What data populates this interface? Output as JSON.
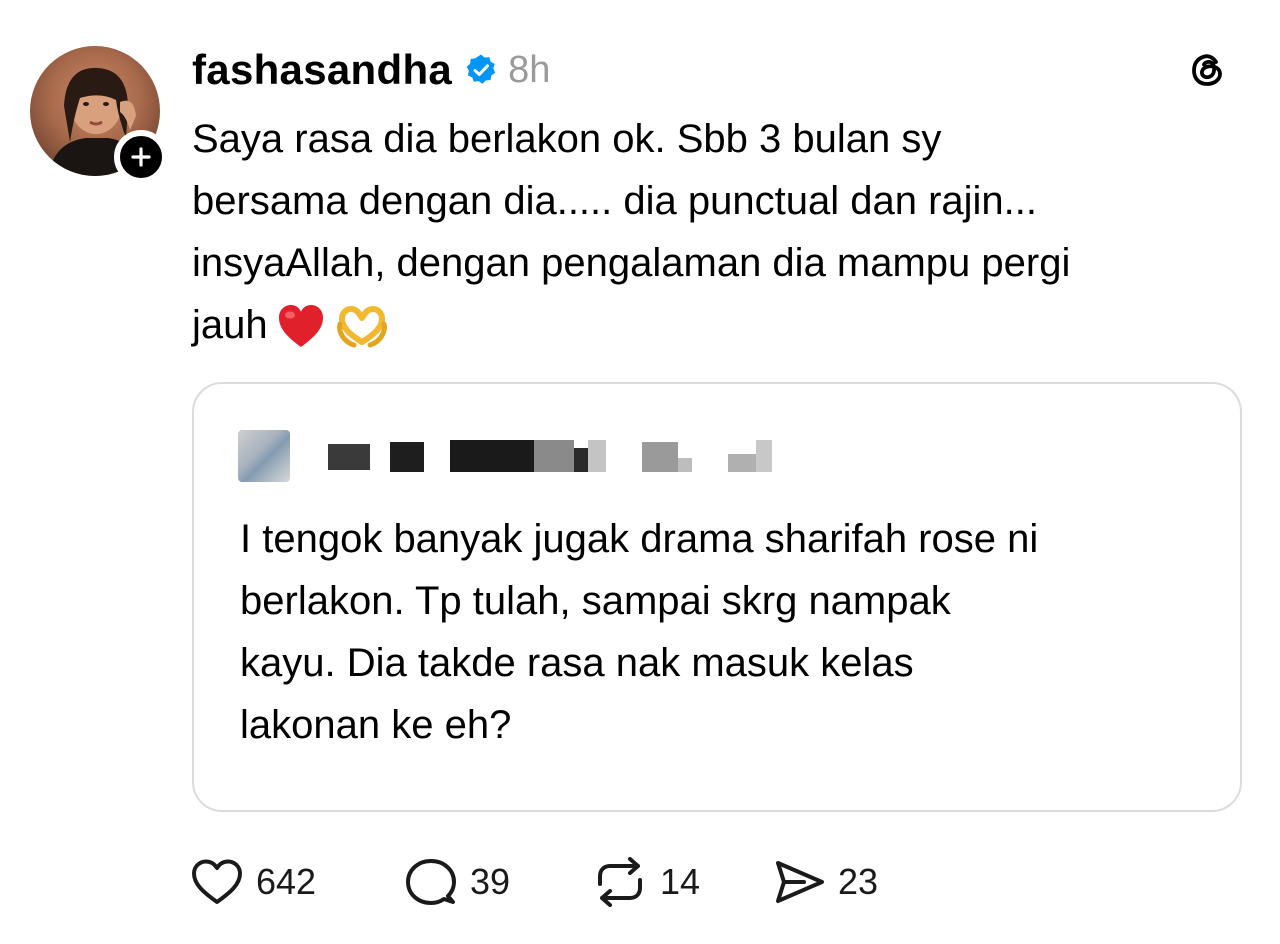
{
  "post": {
    "username": "fashasandha",
    "timestamp": "8h",
    "text_lines": [
      "Saya rasa dia berlakon ok. Sbb 3 bulan sy",
      "bersama dengan dia..... dia punctual dan rajin...",
      "insyaAllah, dengan pengalaman dia mampu pergi",
      "jauh"
    ],
    "emojis": [
      "heart-emoji",
      "heart-hands-emoji"
    ]
  },
  "quote": {
    "author_obscured": true,
    "text_lines": [
      "I tengok banyak jugak drama sharifah rose ni",
      "berlakon. Tp tulah, sampai skrg nampak",
      "kayu. Dia takde rasa nak masuk kelas",
      "lakonan ke eh?"
    ]
  },
  "actions": {
    "likes": "642",
    "replies": "39",
    "reposts": "14",
    "shares": "23"
  },
  "icons": {
    "verified": "verified-badge-icon",
    "threads": "threads-logo-icon",
    "follow": "plus-icon",
    "like": "heart-icon",
    "reply": "comment-bubble-icon",
    "repost": "repost-icon",
    "share": "send-icon"
  },
  "colors": {
    "verified_blue": "#0095f6",
    "timestamp_gray": "#9a9a9a",
    "card_border": "#dcdcdc"
  }
}
